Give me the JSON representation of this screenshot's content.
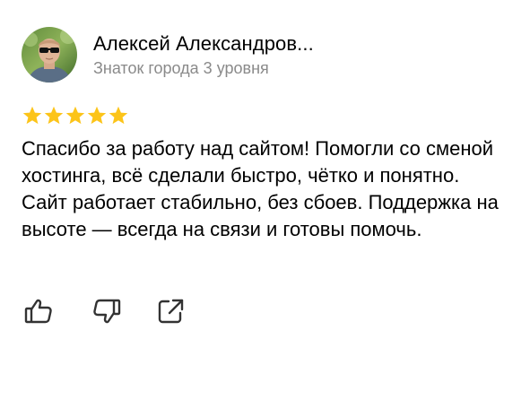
{
  "author": {
    "name": "Алексей Александров...",
    "level": "Знаток города 3 уровня"
  },
  "rating": {
    "stars": 5,
    "max": 5,
    "star_color": "#fcc419"
  },
  "review": {
    "text": "Спасибо за работу над сайтом! Помогли со сменой хостинга, всё сделали быстро, чётко и понятно. Сайт работает стабильно, без сбоев. Поддержка на высоте — всегда на связи и готовы помочь."
  },
  "actions": {
    "like_icon": "thumbs-up-icon",
    "dislike_icon": "thumbs-down-icon",
    "share_icon": "share-icon"
  },
  "colors": {
    "icon_stroke": "#333333",
    "secondary_text": "#8a8a8a"
  }
}
